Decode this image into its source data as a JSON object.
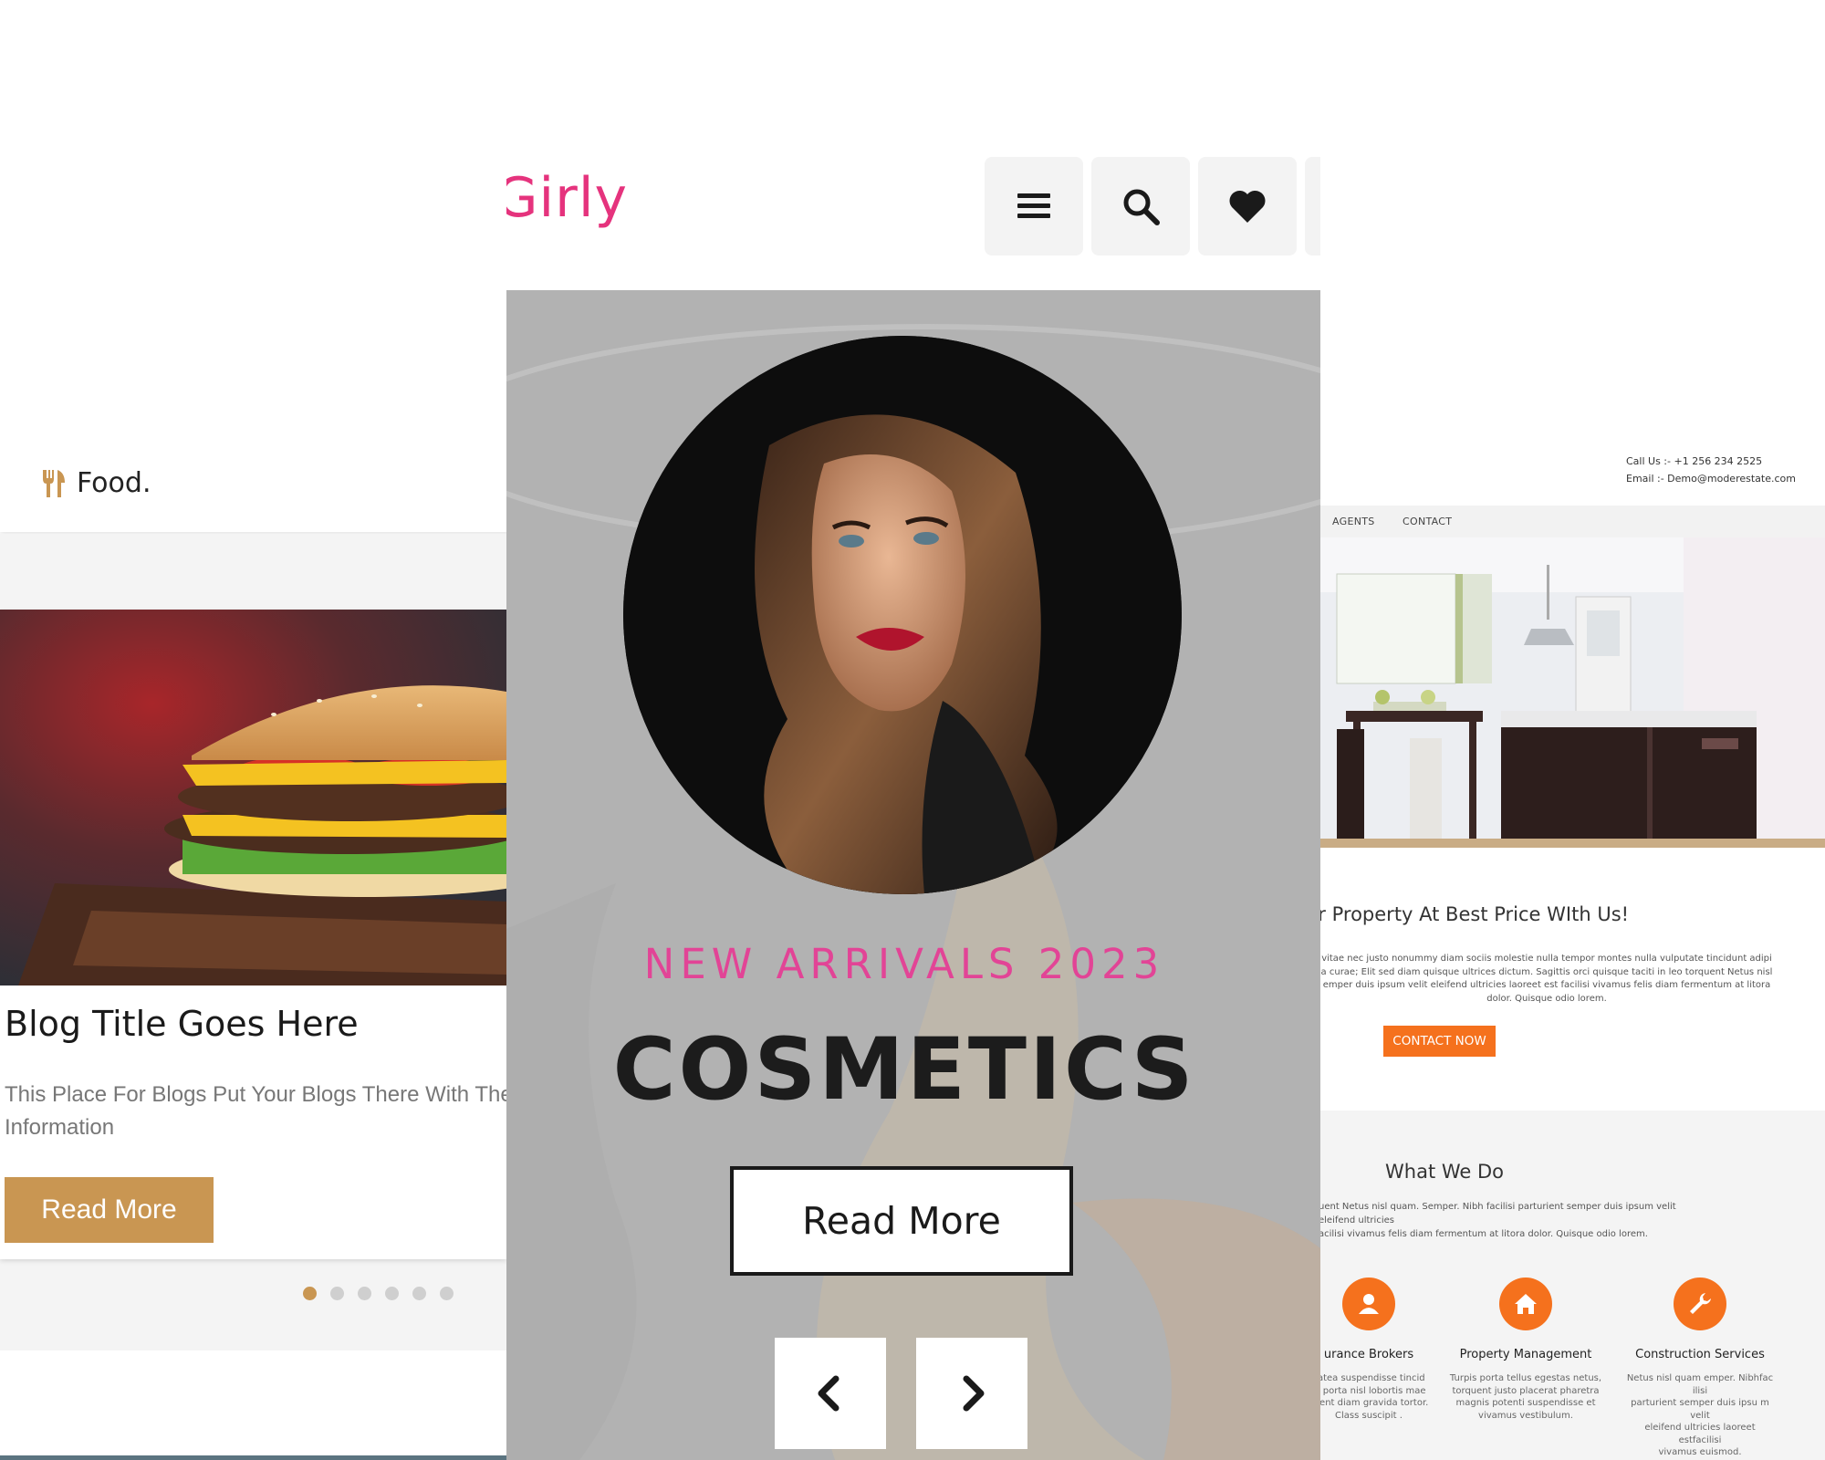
{
  "food": {
    "logo_text": "Food.",
    "blog_title": "Blog Title Goes Here",
    "blog_text_line1": "This Place For Blogs Put Your Blogs There With The Admin A",
    "blog_text_line2": "Information",
    "read_more": "Read More",
    "carousel": {
      "total_dots": 6,
      "active_index": 0
    },
    "accent_color": "#c99652"
  },
  "girly": {
    "brand": "Girly",
    "icons": [
      "menu-icon",
      "search-icon",
      "heart-icon"
    ],
    "subtitle": "NEW ARRIVALS 2023",
    "title": "COSMETICS",
    "read_more": "Read More",
    "accent_color": "#e5337d"
  },
  "estate": {
    "call": "Call Us :- +1 256 234 2525",
    "email": "Email :- Demo@moderestate.com",
    "nav": [
      "AGENTS",
      "CONTACT"
    ],
    "headline": "ur Property At Best Price WIth Us!",
    "para_line1": "vitae nec justo nonummy diam sociis molestie nulla tempor montes nulla vulputate tincidunt adipi",
    "para_line2": "a curae; Elit sed diam quisque ultrices dictum. Sagittis orci quisque taciti in leo torquent Netus nisl",
    "para_line3": "emper duis ipsum velit eleifend ultricies laoreet est facilisi vivamus felis diam fermentum at litora",
    "para_line4": "dolor. Quisque odio lorem.",
    "contact_btn": "CONTACT NOW",
    "what_we_do": "What We Do",
    "wwd_line1": "uent Netus nisl quam. Semper. Nibh facilisi parturient semper duis ipsum velit eleifend ultricies",
    "wwd_line2": "acilisi vivamus felis diam fermentum at litora dolor. Quisque odio lorem.",
    "services": [
      {
        "title": "urance Brokers",
        "icon": "agent-icon",
        "text": [
          "llatea suspendisse tincid",
          "in porta nisl lobortis mae",
          "esent diam gravida tortor.",
          "Class suscipit ."
        ]
      },
      {
        "title": "Property Management",
        "icon": "home-icon",
        "text": [
          "Turpis porta tellus egestas netus,",
          "torquent justo placerat pharetra",
          "magnis potenti suspendisse et",
          "vivamus vestibulum."
        ]
      },
      {
        "title": "Construction Services",
        "icon": "wrench-icon",
        "text": [
          "Netus nisl quam emper. Nibhfac ilisi",
          "parturient semper duis ipsu m velit",
          "eleifend ultricies laoreet estfacilisi",
          "vivamus euismod."
        ]
      }
    ],
    "accent_color": "#f5711d"
  }
}
